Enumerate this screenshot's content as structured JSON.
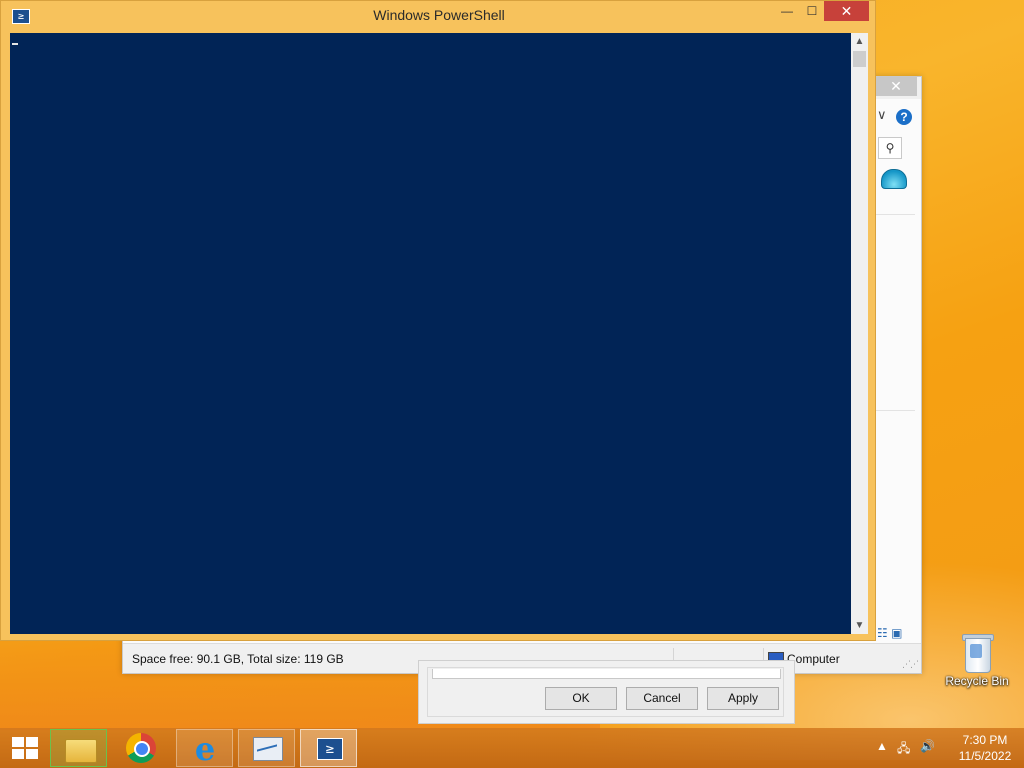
{
  "desktop": {
    "recycle_bin_label": "Recycle Bin"
  },
  "explorer": {
    "close_glyph": "✕",
    "status_text": "Space free: 90.1 GB, Total size: 119 GB",
    "status_location": "Computer",
    "help_glyph": "?",
    "chevron_glyph": "∨",
    "search_glyph": "⚲"
  },
  "dialog": {
    "ok_label": "OK",
    "cancel_label": "Cancel",
    "apply_label": "Apply"
  },
  "powershell": {
    "title": "Windows PowerShell",
    "icon_glyph": "≥",
    "minimize_glyph": "—",
    "maximize_glyph": "☐",
    "close_glyph": "✕",
    "scroll_up_glyph": "▲",
    "scroll_down_glyph": "▼",
    "console_bg": "#012456"
  },
  "taskbar": {
    "apps": [
      "file-explorer",
      "chrome",
      "internet-explorer",
      "performance-monitor",
      "windows-powershell"
    ],
    "tray": {
      "chevron_glyph": "▲",
      "network_glyph": "🖧",
      "volume_glyph": "🔊"
    },
    "clock_time": "7:30 PM",
    "clock_date": "11/5/2022"
  },
  "colors": {
    "wallpaper": "#f7a81b",
    "accent_title": "#f7c25c",
    "close_red": "#c7413a"
  }
}
